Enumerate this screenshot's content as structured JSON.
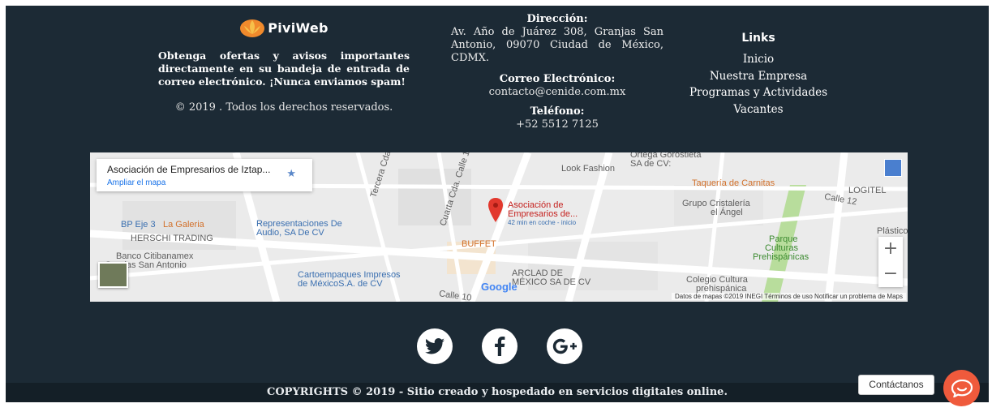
{
  "brand": {
    "name": "PiviWeb",
    "tagline": "Obtenga ofertas y avisos importantes directamente en su bandeja de entrada de correo electrónico. ¡Nunca enviamos spam!",
    "rights": "© 2019 . Todos los derechos reservados."
  },
  "contact": {
    "address_label": "Dirección:",
    "address": "Av. Año de Juárez 308, Granjas San Antonio, 09070 Ciudad de México, CDMX.",
    "email_label": "Correo Electrónico:",
    "email": "contacto@cenide.com.mx",
    "phone_label": "Teléfono:",
    "phone": "+52 5512 7125"
  },
  "links": {
    "title": "Links",
    "items": [
      {
        "label": "Inicio"
      },
      {
        "label": "Nuestra Empresa"
      },
      {
        "label": "Programas y Actividades"
      },
      {
        "label": "Vacantes"
      }
    ]
  },
  "map": {
    "card_title": "Asociación de Empresarios de Iztap...",
    "card_link": "Ampliar el mapa",
    "pin_label_1": "Asociación de",
    "pin_label_2": "Empresarios de...",
    "pin_sub": "42 min en coche - inicio",
    "google": "Google",
    "attribution": "Datos de mapas ©2019 INEGI   Términos de uso   Notificar un problema de Maps",
    "zoom_in": "+",
    "zoom_out": "−",
    "places": {
      "look_fashion": "Look Fashion",
      "ortega_1": "Ortega Gorostieta",
      "ortega_2": "SA de CV:",
      "taqueria": "Taquería de Carnitas",
      "cristaleria_1": "Grupo Cristalería",
      "cristaleria_2": "el Ángel",
      "logitel": "LOGITEL",
      "calle12": "Calle 12",
      "plastico": "Plástico",
      "parque_1": "Parque",
      "parque_2": "Culturas",
      "parque_3": "Prehispánicas",
      "buffet": "BUFFET",
      "arclad_1": "ARCLAD DE",
      "arclad_2": "MÉXICO SA DE CV",
      "colegio_1": "Colegio Cultura",
      "colegio_2": "prehispánica",
      "calle10": "Calle 10",
      "bp": "BP Eje 3",
      "galeria": "La Galeria",
      "herschi": "HERSCHI TRADING",
      "citibanamex": "Banco Citibanamex",
      "granjas": "Granjas San Antonio",
      "repr_1": "Representaciones De",
      "repr_2": "Audio, SA De CV",
      "carto_1": "Cartoempaques Impresos",
      "carto_2": "de MéxicoS.A. de CV",
      "tercera": "Tercera Cda.",
      "cuarta": "Cuarta Cda. Calle 10"
    }
  },
  "social": [
    {
      "icon": "twitter-icon"
    },
    {
      "icon": "facebook-icon"
    },
    {
      "icon": "google-plus-icon"
    }
  ],
  "copyright": "COPYRIGHTS © 2019 - Sitio creado y hospedado en servicios digitales online.",
  "widget": {
    "label": "Contáctanos",
    "icon": "chat-icon",
    "color": "#ef5a3c"
  },
  "colors": {
    "footer_bg": "#1c2a35",
    "copybar_bg": "#141f27"
  }
}
